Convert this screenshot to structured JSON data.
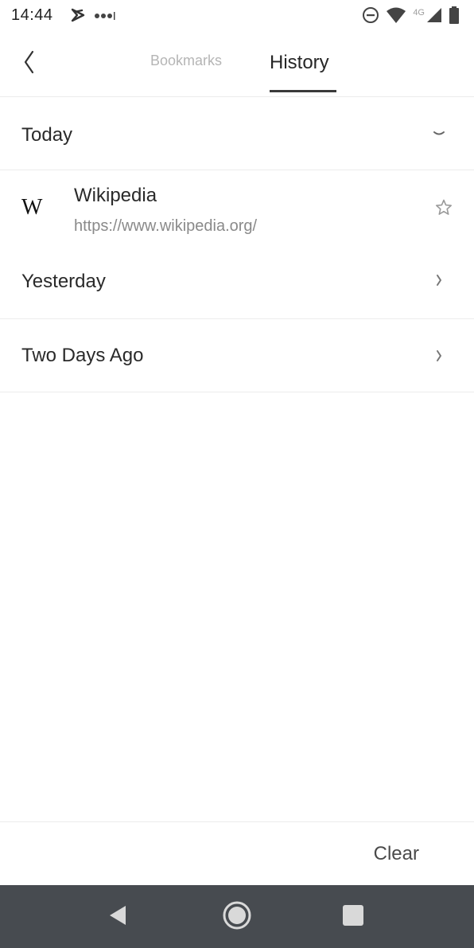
{
  "status_bar": {
    "time": "14:44",
    "network_label": "4G",
    "icons": [
      "notification-icon",
      "more-dots-icon",
      "dnd-icon",
      "wifi-icon",
      "signal-icon",
      "battery-icon"
    ]
  },
  "header": {
    "tabs": [
      {
        "label": "Bookmarks",
        "selected": false
      },
      {
        "label": "History",
        "selected": true
      }
    ]
  },
  "history": {
    "sections": [
      {
        "label": "Today",
        "expanded": true
      },
      {
        "label": "Yesterday",
        "expanded": false
      },
      {
        "label": "Two Days Ago",
        "expanded": false
      }
    ],
    "today_items": [
      {
        "logo_text": "W",
        "title": "Wikipedia",
        "url": "https://www.wikipedia.org/",
        "icon": "star-icon"
      }
    ]
  },
  "footer": {
    "clear_label": "Clear"
  },
  "colors": {
    "nav_bar": "#474b50",
    "tab_active": "#262626",
    "tab_inactive": "#b5b5b5",
    "url_text": "#8a8a8a"
  }
}
